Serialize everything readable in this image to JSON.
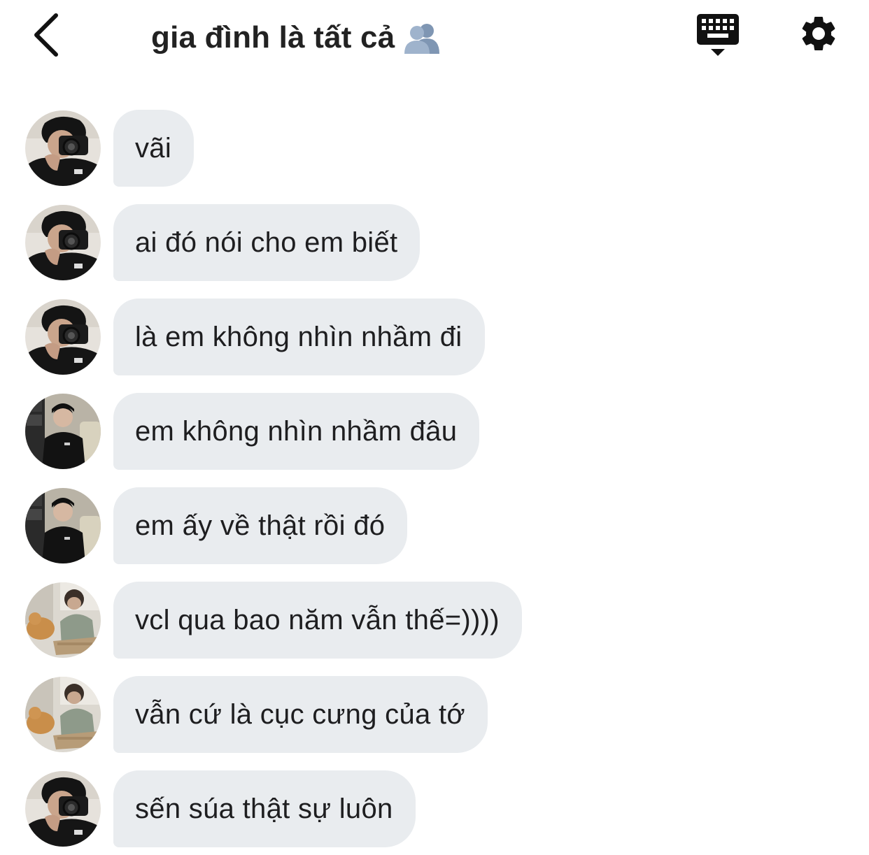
{
  "header": {
    "title": "gia đình là tất cả",
    "title_emoji": "busts-in-silhouette",
    "back_icon": "chevron-left-icon",
    "keyboard_icon": "keyboard-icon",
    "settings_icon": "gear-icon"
  },
  "colors": {
    "bubble_bg": "#e9ecef",
    "text": "#1e1e20",
    "title": "#222222"
  },
  "messages": [
    {
      "avatar": "camera-person",
      "text": "vãi"
    },
    {
      "avatar": "camera-person",
      "text": "ai đó nói cho em biết"
    },
    {
      "avatar": "camera-person",
      "text": "là em không nhìn nhầm đi"
    },
    {
      "avatar": "seated-person",
      "text": "em không nhìn nhầm đâu"
    },
    {
      "avatar": "seated-person",
      "text": "em ấy về thật rồi đó"
    },
    {
      "avatar": "cat-person",
      "text": "vcl qua bao năm vẫn thế=))))"
    },
    {
      "avatar": "cat-person",
      "text": "vẫn cứ là cục cưng của tớ"
    },
    {
      "avatar": "camera-person",
      "text": "sến súa thật sự luôn"
    }
  ]
}
